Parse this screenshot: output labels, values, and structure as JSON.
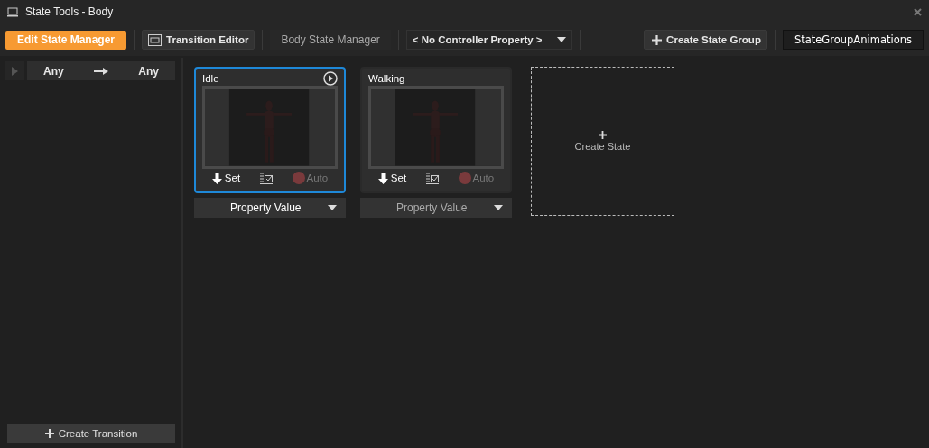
{
  "window": {
    "title": "State Tools - Body"
  },
  "toolbar": {
    "edit_button": "Edit State Manager",
    "transition_editor": "Transition Editor",
    "state_manager": "Body State Manager",
    "controller_dropdown": "< No Controller Property >",
    "create_group": "Create State Group",
    "group_name": "StateGroupAnimations"
  },
  "transitions": [
    {
      "from": "Any",
      "to": "Any"
    }
  ],
  "create_transition": "Create Transition",
  "states": [
    {
      "name": "Idle",
      "selected": true,
      "set": "Set",
      "auto": "Auto",
      "property": "Property Value",
      "property_active": true
    },
    {
      "name": "Walking",
      "selected": false,
      "set": "Set",
      "auto": "Auto",
      "property": "Property Value",
      "property_active": false
    }
  ],
  "create_state": "Create State"
}
